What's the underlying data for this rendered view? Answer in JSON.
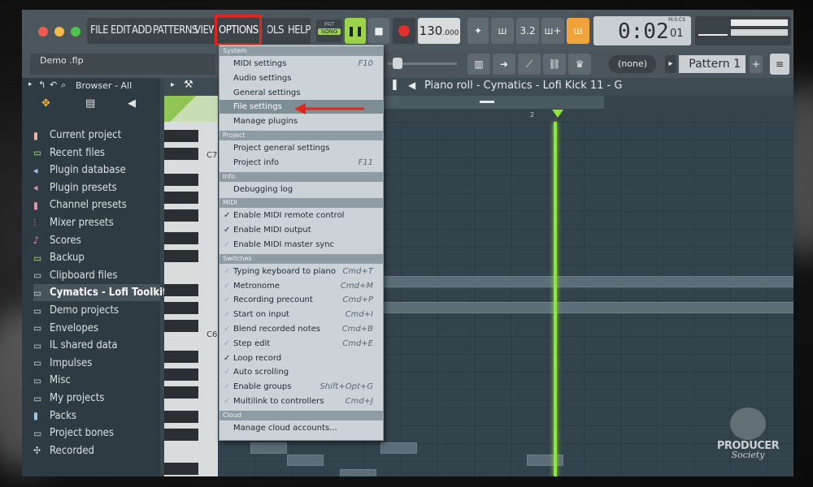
{
  "app": {
    "file_name": "Demo .flp",
    "tempo": "130",
    "tempo_decimals": ".000",
    "time": "0:02",
    "time_sub": "01",
    "time_format": "M:S:CS",
    "pat_label": "PAT",
    "song_label": "SONG",
    "pattern": "Pattern 1",
    "none_label": "(none)"
  },
  "menu": {
    "items": [
      "FILE",
      "EDIT",
      "ADD",
      "PATTERNS",
      "VIEW",
      "OPTIONS",
      "TOOLS",
      "HELP"
    ]
  },
  "options_menu": {
    "sections": [
      {
        "title": "System",
        "items": [
          {
            "label": "MIDI settings",
            "shortcut": "F10"
          },
          {
            "label": "Audio settings",
            "shortcut": ""
          },
          {
            "label": "General settings",
            "shortcut": ""
          },
          {
            "label": "File settings",
            "shortcut": "",
            "selected": true
          },
          {
            "label": "Manage plugins",
            "shortcut": ""
          }
        ]
      },
      {
        "title": "Project",
        "items": [
          {
            "label": "Project general settings",
            "shortcut": ""
          },
          {
            "label": "Project info",
            "shortcut": "F11"
          }
        ]
      },
      {
        "title": "Info",
        "items": [
          {
            "label": "Debugging log",
            "shortcut": ""
          }
        ]
      },
      {
        "title": "MIDI",
        "items": [
          {
            "label": "Enable MIDI remote control",
            "shortcut": "",
            "check": "on"
          },
          {
            "label": "Enable MIDI output",
            "shortcut": "",
            "check": "on"
          },
          {
            "label": "Enable MIDI master sync",
            "shortcut": "",
            "check": "off"
          }
        ]
      },
      {
        "title": "Switches",
        "items": [
          {
            "label": "Typing keyboard to piano",
            "shortcut": "Cmd+T",
            "check": "off"
          },
          {
            "label": "Metronome",
            "shortcut": "Cmd+M",
            "check": "off"
          },
          {
            "label": "Recording precount",
            "shortcut": "Cmd+P",
            "check": "off"
          },
          {
            "label": "Start on input",
            "shortcut": "Cmd+I",
            "check": "off"
          },
          {
            "label": "Blend recorded notes",
            "shortcut": "Cmd+B",
            "check": "off"
          },
          {
            "label": "Step edit",
            "shortcut": "Cmd+E",
            "check": "off"
          },
          {
            "label": "Loop record",
            "shortcut": "",
            "check": "on"
          },
          {
            "label": "Auto scrolling",
            "shortcut": "",
            "check": "off"
          },
          {
            "label": "Enable groups",
            "shortcut": "Shift+Opt+G",
            "check": "off"
          },
          {
            "label": "Multilink to controllers",
            "shortcut": "Cmd+J",
            "check": "off"
          }
        ]
      },
      {
        "title": "Cloud",
        "items": [
          {
            "label": "Manage cloud accounts...",
            "shortcut": ""
          }
        ]
      }
    ]
  },
  "browser": {
    "title": "Browser - All",
    "items": [
      {
        "label": "Current project",
        "icon": "project-icon"
      },
      {
        "label": "Recent files",
        "icon": "recent-folder-icon"
      },
      {
        "label": "Plugin database",
        "icon": "plugin-icon"
      },
      {
        "label": "Plugin presets",
        "icon": "preset-icon"
      },
      {
        "label": "Channel presets",
        "icon": "channel-icon"
      },
      {
        "label": "Mixer presets",
        "icon": "mixer-icon"
      },
      {
        "label": "Scores",
        "icon": "note-icon"
      },
      {
        "label": "Backup",
        "icon": "backup-folder-icon"
      },
      {
        "label": "Clipboard files",
        "icon": "folder-icon"
      },
      {
        "label": "Cymatics - Lofi Toolkit",
        "icon": "folder-icon",
        "selected": true
      },
      {
        "label": "Demo projects",
        "icon": "folder-icon"
      },
      {
        "label": "Envelopes",
        "icon": "folder-icon"
      },
      {
        "label": "IL shared data",
        "icon": "folder-icon"
      },
      {
        "label": "Impulses",
        "icon": "folder-icon"
      },
      {
        "label": "Misc",
        "icon": "folder-icon"
      },
      {
        "label": "My projects",
        "icon": "folder-icon"
      },
      {
        "label": "Packs",
        "icon": "packs-icon"
      },
      {
        "label": "Project bones",
        "icon": "folder-icon"
      },
      {
        "label": "Recorded",
        "icon": "recorded-icon"
      }
    ]
  },
  "piano_roll": {
    "title": "Piano roll - Cymatics - Lofi Kick 11 - G",
    "bar_marker": "2",
    "octave_labels": [
      "C7",
      "C6"
    ]
  },
  "watermark": {
    "line1": "PRODUCER",
    "line2": "Society"
  },
  "colors": {
    "accent_green": "#8ee63c",
    "highlight_red": "#e3261c",
    "record_red": "#e0312f",
    "orange_button": "#f0a33a"
  }
}
